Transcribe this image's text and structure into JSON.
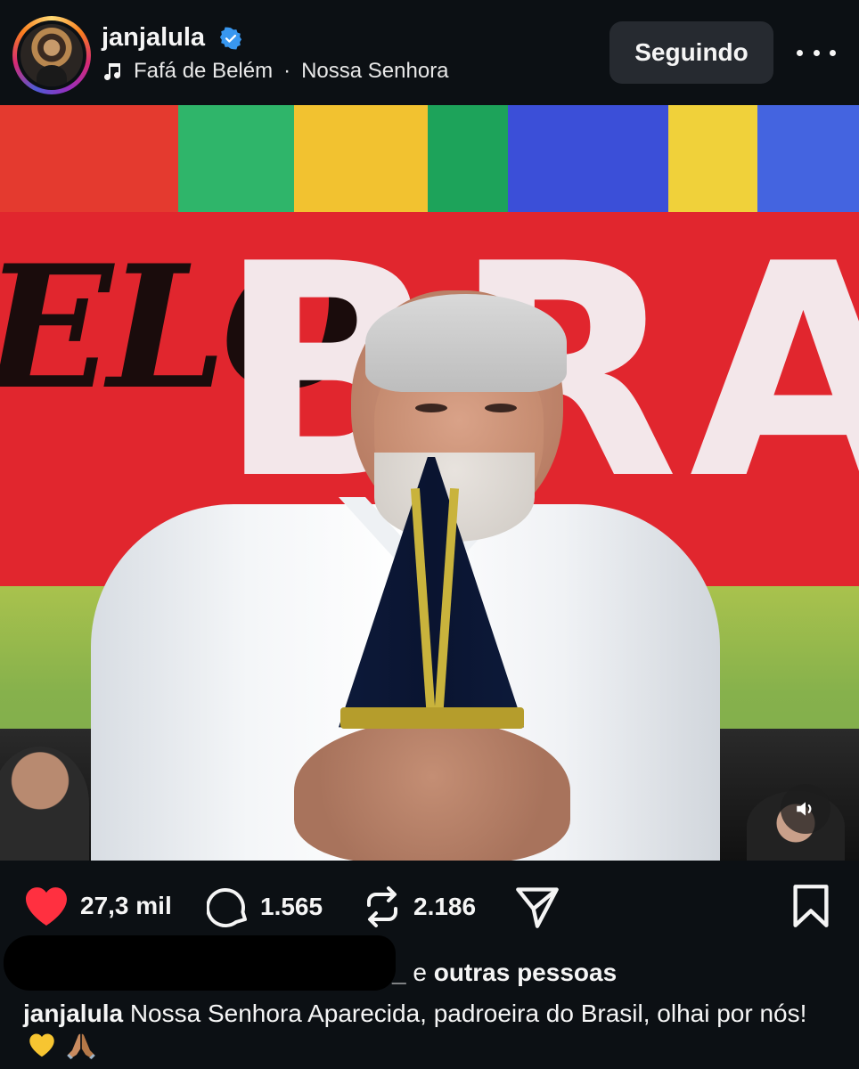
{
  "header": {
    "username": "janjalula",
    "music_artist": "Fafá de Belém",
    "music_separator": "·",
    "music_title": "Nossa Senhora",
    "follow_label": "Seguindo"
  },
  "media": {
    "banner_text_left": "ELO",
    "banner_text_right": "BRA"
  },
  "actions": {
    "likes": "27,3 mil",
    "comments": "1.565",
    "reposts": "2.186"
  },
  "liked_by": {
    "suffix_user": "_",
    "connector": "e",
    "others": "outras pessoas"
  },
  "caption": {
    "user": "janjalula",
    "text": "Nossa Senhora Aparecida, padroeira do Brasil, olhai por nós!"
  },
  "colors": {
    "background": "#0c1014",
    "like_red": "#ff3040",
    "verified_blue": "#3897f0",
    "follow_button": "#262a30"
  },
  "icons": {
    "verified": "verified-badge-icon",
    "music": "music-note-icon",
    "more": "more-options-icon",
    "sound": "speaker-icon",
    "like": "heart-icon",
    "comment": "comment-bubble-icon",
    "repost": "repost-icon",
    "share": "send-icon",
    "save": "bookmark-icon"
  }
}
